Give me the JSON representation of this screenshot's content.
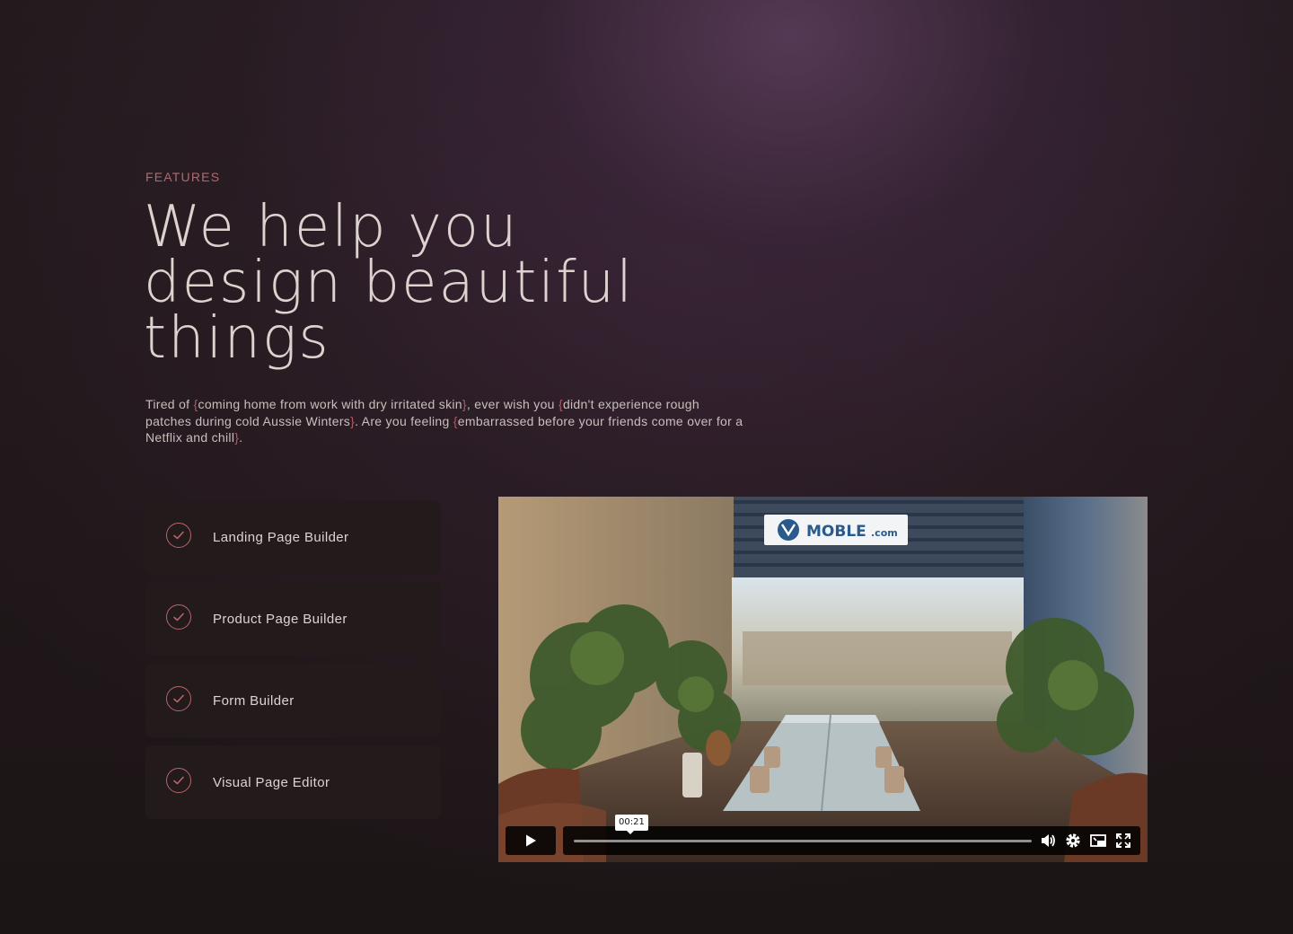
{
  "section": {
    "eyebrow": "FEATURES",
    "headline": [
      "We help you",
      "design beautiful",
      "things"
    ],
    "intro": {
      "t1": "Tired of ",
      "b1": "coming home from work with dry irritated skin",
      "t2": ", ever wish you ",
      "b2": "didn't experience rough patches during cold Aussie Winters",
      "t3": ". Are you feeling ",
      "b3": "embarrassed before your friends come over for a Netflix and chill",
      "t4": ".",
      "brace_open": "{",
      "brace_close": "}"
    }
  },
  "features": [
    {
      "label": "Landing Page Builder",
      "icon": "check-circle-icon"
    },
    {
      "label": "Product Page Builder",
      "icon": "check-circle-icon"
    },
    {
      "label": "Form Builder",
      "icon": "check-circle-icon"
    },
    {
      "label": "Visual Page Editor",
      "icon": "check-circle-icon"
    }
  ],
  "video": {
    "sign_text": "MOBLE",
    "sign_suffix": ".com",
    "timecode": "00:21",
    "controls": [
      "play-icon",
      "volume-icon",
      "settings-gear-icon",
      "picture-in-picture-icon",
      "fullscreen-icon"
    ]
  },
  "colors": {
    "accent": "#b25a63",
    "text": "#e6dcd8",
    "card": "#231a1b",
    "background": "#1c1516"
  }
}
